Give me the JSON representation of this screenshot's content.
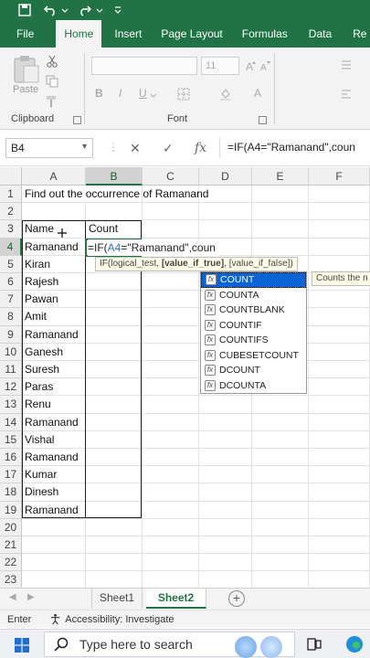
{
  "ribbon": {
    "tabs": [
      "File",
      "Home",
      "Insert",
      "Page Layout",
      "Formulas",
      "Data",
      "Re"
    ],
    "active_tab": "Home",
    "paste_label": "Paste",
    "font_size": "11",
    "group_clipboard": "Clipboard",
    "group_font": "Font",
    "bold": "B",
    "italic": "I",
    "underline": "U",
    "font_color": "A"
  },
  "formula_bar": {
    "name_box": "B4",
    "cancel": "✕",
    "enter": "✓",
    "fx": "fx",
    "formula": "=IF(A4=\"Ramanand\",coun"
  },
  "columns": [
    "A",
    "B",
    "C",
    "D",
    "E",
    "F"
  ],
  "rows": [
    "1",
    "2",
    "3",
    "4",
    "5",
    "6",
    "7",
    "8",
    "9",
    "10",
    "11",
    "12",
    "13",
    "14",
    "15",
    "16",
    "17",
    "18",
    "19",
    "20",
    "21",
    "22",
    "23"
  ],
  "cells": {
    "A1": "Find out the occurrence of Ramanand",
    "A3": "Name",
    "B3": "Count",
    "A4": "Ramanand",
    "A5": "Kiran",
    "A6": "Rajesh",
    "A7": "Pawan",
    "A8": "Amit",
    "A9": "Ramanand",
    "A10": "Ganesh",
    "A11": "Suresh",
    "A12": "Paras",
    "A13": "Renu",
    "A14": "Ramanand",
    "A15": "Vishal",
    "A16": "Ramanand",
    "A17": "Kumar",
    "A18": "Dinesh",
    "A19": "Ramanand"
  },
  "editing": {
    "prefix": "=IF(",
    "ref": "A4",
    "suffix": "=\"Ramanand\",coun"
  },
  "tooltip": {
    "part1": "IF(logical_test, ",
    "bold": "[value_if_true]",
    "part2": ", [value_if_false])"
  },
  "autocomplete": {
    "items": [
      "COUNT",
      "COUNTA",
      "COUNTBLANK",
      "COUNTIF",
      "COUNTIFS",
      "CUBESETCOUNT",
      "DCOUNT",
      "DCOUNTA"
    ],
    "selected": "COUNT",
    "description": "Counts the n"
  },
  "sheets": {
    "tabs": [
      "Sheet1",
      "Sheet2"
    ],
    "active": "Sheet2",
    "add": "+"
  },
  "status": {
    "mode": "Enter",
    "accessibility": "Accessibility: Investigate"
  },
  "taskbar": {
    "search_placeholder": "Type here to search"
  },
  "colors": {
    "excel_green": "#217346",
    "selection_blue": "#0a64d6"
  }
}
